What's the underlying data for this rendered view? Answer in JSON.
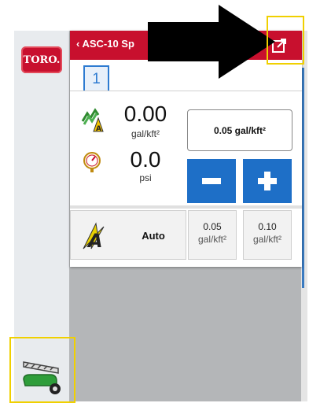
{
  "brand": {
    "logo_text": "TORO."
  },
  "panel": {
    "back_label": "‹ ASC-10 Sp",
    "section_tab": "1",
    "rate": {
      "value": "0.00",
      "unit": "gal/kft²"
    },
    "pressure": {
      "value": "0.0",
      "unit": "psi"
    },
    "target_rate": "0.05 gal/kft²",
    "auto_label": "Auto",
    "presets": [
      {
        "value": "0.05",
        "unit": "gal/kft²"
      },
      {
        "value": "0.10",
        "unit": "gal/kft²"
      }
    ]
  },
  "icons": {
    "popout": "popout-icon",
    "back": "chevron-left-icon",
    "rate": "spray-rate-icon",
    "pressure": "pressure-gauge-icon",
    "minus": "minus-icon",
    "plus": "plus-icon",
    "auto": "auto-mode-icon",
    "sprayer": "sprayer-icon"
  },
  "colors": {
    "brand_red": "#c8102e",
    "accent_blue": "#1e6fc7",
    "highlight_yellow": "#f0d000"
  }
}
